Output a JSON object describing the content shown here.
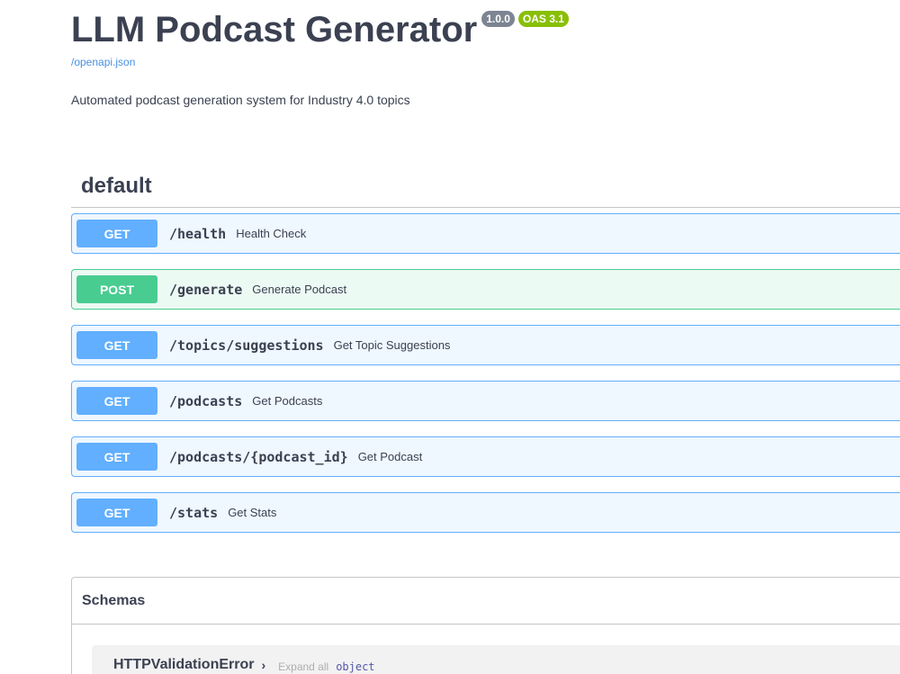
{
  "info": {
    "title": "LLM Podcast Generator",
    "version_badge": "1.0.0",
    "oas_badge": "OAS 3.1",
    "spec_link": "/openapi.json",
    "description": "Automated podcast generation system for Industry 4.0 topics"
  },
  "tag": {
    "name": "default"
  },
  "operations": [
    {
      "method": "GET",
      "path": "/health",
      "summary": "Health Check"
    },
    {
      "method": "POST",
      "path": "/generate",
      "summary": "Generate Podcast"
    },
    {
      "method": "GET",
      "path": "/topics/suggestions",
      "summary": "Get Topic Suggestions"
    },
    {
      "method": "GET",
      "path": "/podcasts",
      "summary": "Get Podcasts"
    },
    {
      "method": "GET",
      "path": "/podcasts/{podcast_id}",
      "summary": "Get Podcast"
    },
    {
      "method": "GET",
      "path": "/stats",
      "summary": "Get Stats"
    }
  ],
  "schemas": {
    "title": "Schemas",
    "models": [
      {
        "name": "HTTPValidationError",
        "arrow": "›",
        "expand_label": "Expand all",
        "type": "object"
      }
    ]
  },
  "colors": {
    "get": "#61affe",
    "post": "#49cc90",
    "link": "#4990e2",
    "version_badge": "#7d8492",
    "oas_badge": "#89bf04"
  }
}
